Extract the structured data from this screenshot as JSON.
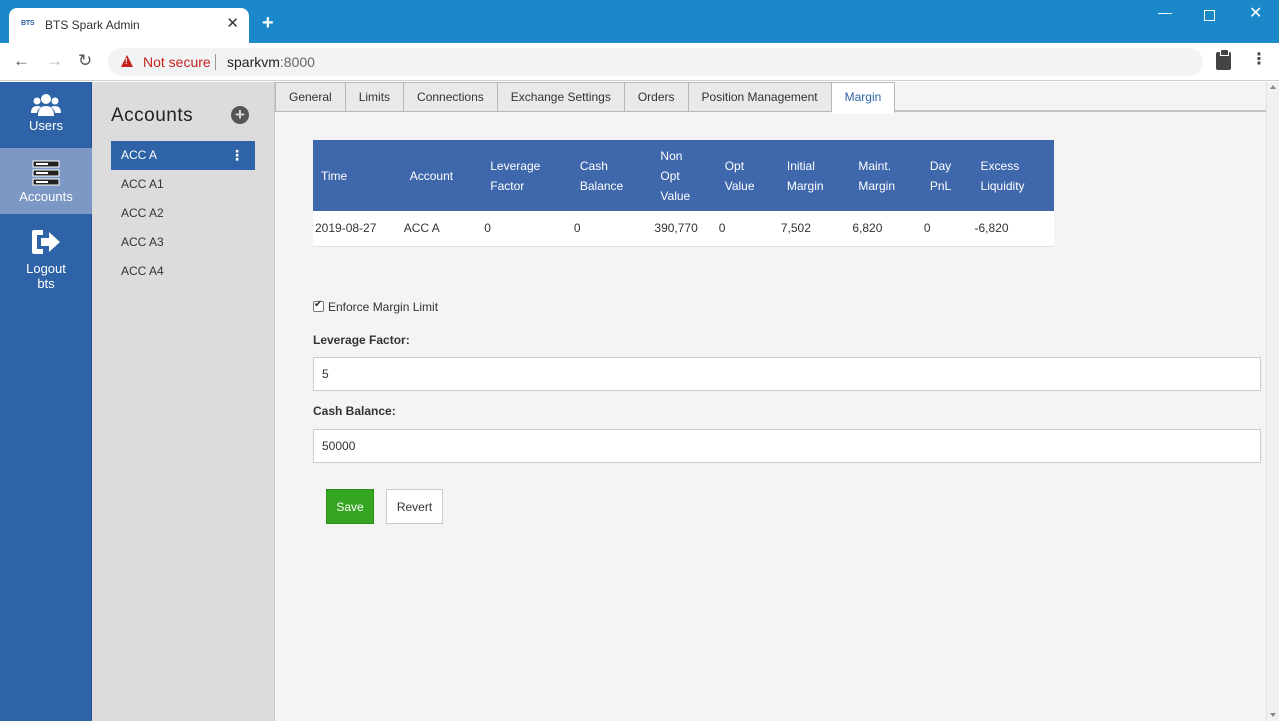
{
  "browser": {
    "tab_favicon": "BTS",
    "tab_title": "BTS Spark Admin",
    "security_label": "Not secure",
    "url_host": "sparkvm",
    "url_port": ":8000"
  },
  "sidebar": {
    "items": [
      {
        "label": "Users",
        "icon": "users-icon"
      },
      {
        "label": "Accounts",
        "icon": "server-icon"
      },
      {
        "label": "Logout",
        "sub": "bts",
        "icon": "logout-icon"
      }
    ]
  },
  "accounts": {
    "title": "Accounts",
    "items": [
      "ACC A",
      "ACC A1",
      "ACC A2",
      "ACC A3",
      "ACC A4"
    ]
  },
  "tabs": [
    "General",
    "Limits",
    "Connections",
    "Exchange Settings",
    "Orders",
    "Position Management",
    "Margin"
  ],
  "margin_table": {
    "headers": [
      [
        "Time"
      ],
      [
        "Account"
      ],
      [
        "Leverage",
        "Factor"
      ],
      [
        "Cash",
        "Balance"
      ],
      [
        "Non",
        "Opt",
        "Value"
      ],
      [
        "Opt",
        "Value"
      ],
      [
        "Initial",
        "Margin"
      ],
      [
        "Maint.",
        "Margin"
      ],
      [
        "Day",
        "PnL"
      ],
      [
        "Excess",
        "Liquidity"
      ]
    ],
    "rows": [
      [
        "2019-08-27",
        "ACC A",
        "0",
        "0",
        "390,770",
        "0",
        "7,502",
        "6,820",
        "0",
        "-6,820"
      ]
    ]
  },
  "form": {
    "enforce_label": "Enforce Margin Limit",
    "enforce_checked": true,
    "leverage_label": "Leverage Factor:",
    "leverage_value": "5",
    "cash_label": "Cash Balance:",
    "cash_value": "50000",
    "save_label": "Save",
    "revert_label": "Revert"
  },
  "colors": {
    "titlebar": "#1a88c9",
    "sidebar": "#2f63a7",
    "table_header": "#3f67ac",
    "save_button": "#35a621",
    "warning": "#c5221f"
  }
}
